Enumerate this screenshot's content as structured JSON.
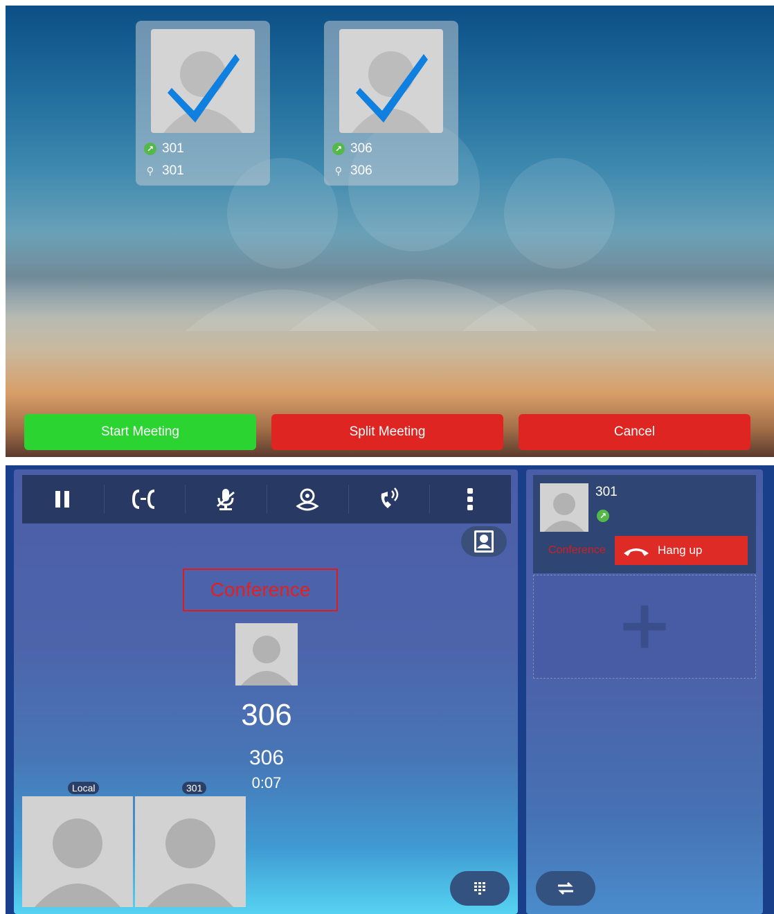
{
  "top_screen": {
    "participants": [
      {
        "name": "301",
        "account": "301"
      },
      {
        "name": "306",
        "account": "306"
      }
    ],
    "buttons": {
      "start_meeting": "Start Meeting",
      "split_meeting": "Split Meeting",
      "cancel": "Cancel"
    },
    "colors": {
      "start": "#2bd431",
      "split": "#df2521",
      "cancel": "#df2521"
    }
  },
  "call_screen": {
    "toolbar_icons": [
      "pause-icon",
      "transfer-icon",
      "mute-mic-icon",
      "record-video-icon",
      "call-volume-icon",
      "more-icon"
    ],
    "status": "Conference",
    "caller_name": "306",
    "caller_number": "306",
    "duration": "0:07",
    "thumbnails": [
      {
        "label": "Local"
      },
      {
        "label": "301"
      }
    ]
  },
  "side_panel": {
    "line": {
      "name": "301",
      "status": "Conference",
      "hangup": "Hang up"
    }
  },
  "colors": {
    "hangup": "#df2b26",
    "conference_text": "#e32020",
    "toolbar": "#283a63"
  }
}
